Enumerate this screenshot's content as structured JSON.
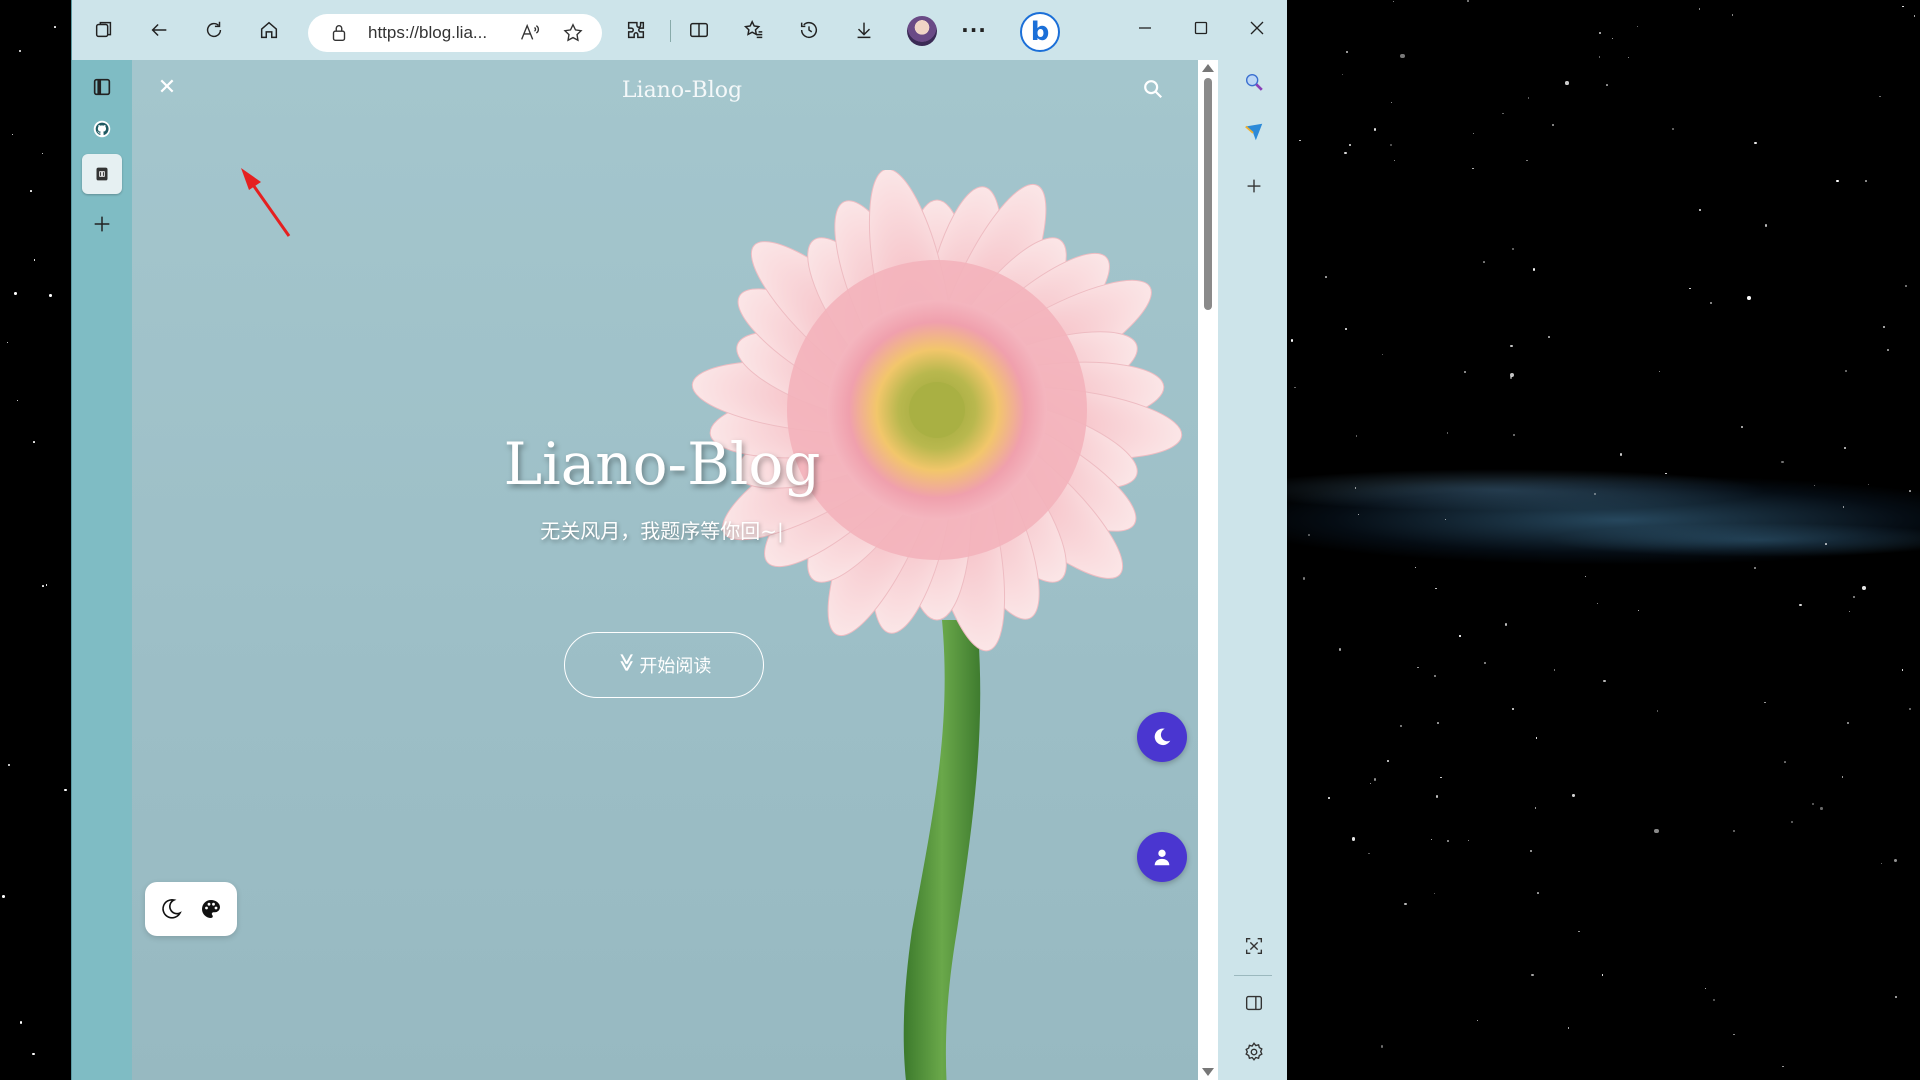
{
  "browser": {
    "url": "https://blog.lia...",
    "icons": {
      "workspaces": "workspaces-icon",
      "back": "back-icon",
      "refresh": "refresh-icon",
      "home": "home-icon",
      "lock": "lock-icon",
      "read_aloud": "read-aloud-icon",
      "favorite": "star-icon",
      "extensions": "extensions-icon",
      "split_screen": "split-screen-icon",
      "favorites": "favorites-icon",
      "history": "history-icon",
      "downloads": "download-icon",
      "profile": "profile-avatar",
      "more": "more-icon",
      "copilot": "bing-icon"
    },
    "more_label": "···",
    "bing_label": "b"
  },
  "page": {
    "nav": {
      "close_symbol": "✕",
      "site_title": "Liano-Blog"
    },
    "hero": {
      "title": "Liano-Blog",
      "subtitle": "无关风月，我题序等你回~|",
      "start_button": "开始阅读",
      "chevron": "≫"
    },
    "colors": {
      "accent": "#4a36d0",
      "background": "#a4c6cd"
    }
  },
  "sidebar": {
    "left": [
      "tab-icon",
      "github-icon",
      "blog-tab-icon",
      "add-icon"
    ],
    "right": [
      "search-icon",
      "send-icon",
      "add-icon",
      "screenshot-icon",
      "sidebar-icon",
      "settings-icon"
    ]
  }
}
